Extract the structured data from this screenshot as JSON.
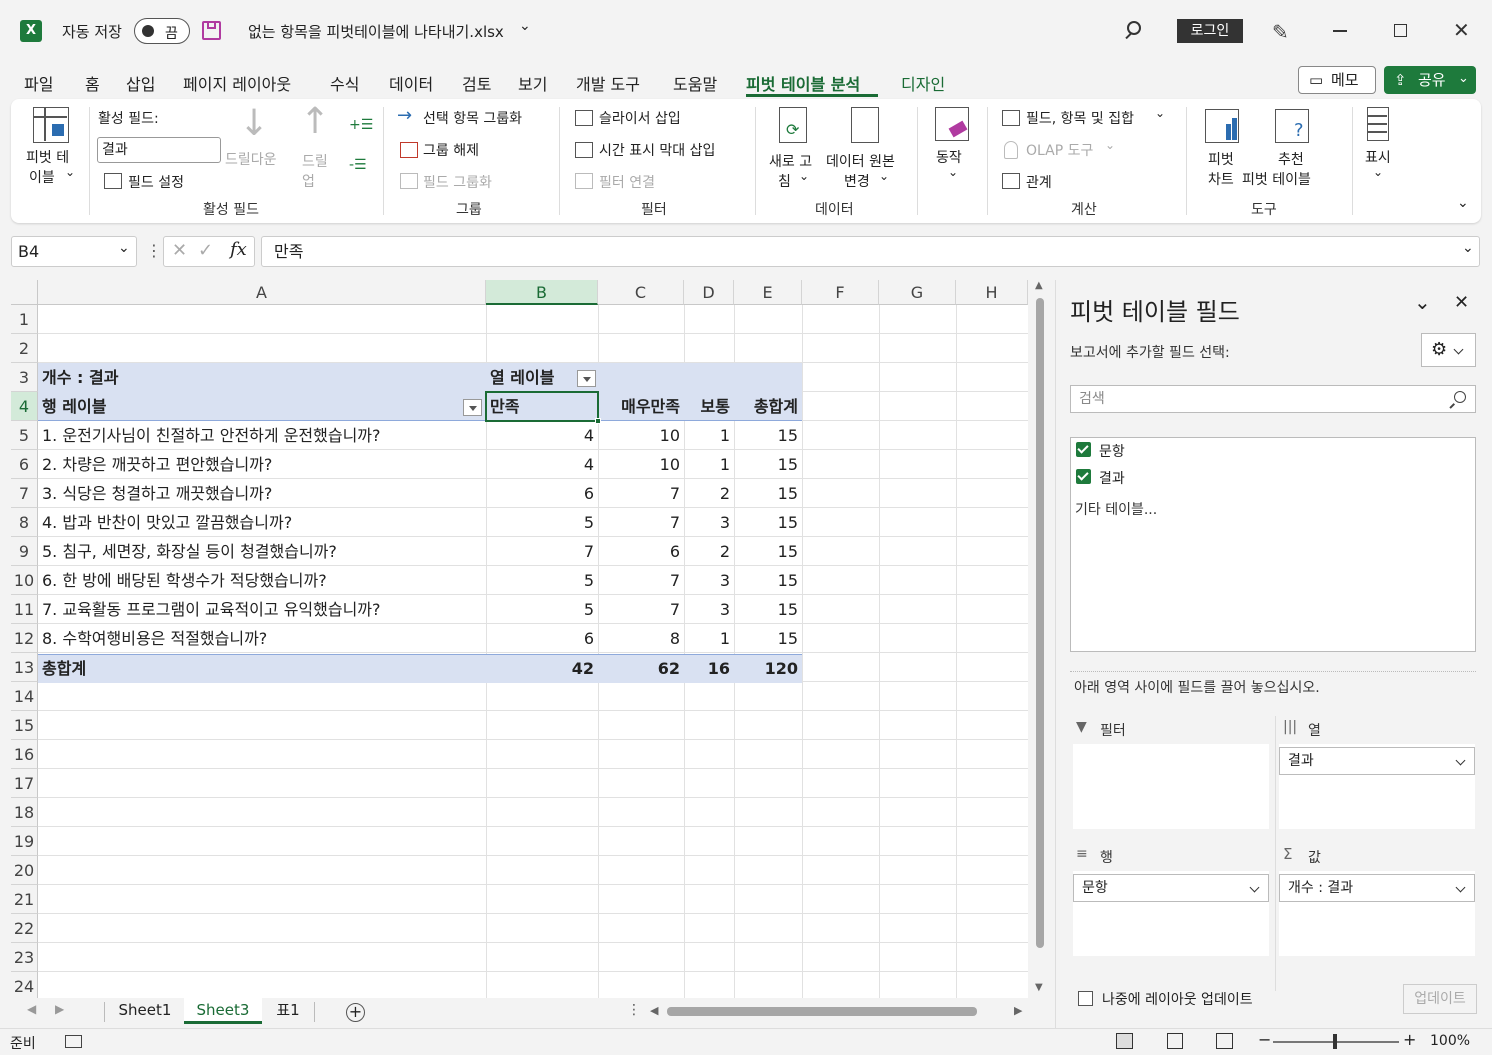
{
  "titlebar": {
    "autosave_label": "자동 저장",
    "autosave_state": "끔",
    "filename": "없는 항목을 피벗테이블에 나타내기.xlsx",
    "login": "로그인"
  },
  "menu": [
    "파일",
    "홈",
    "삽입",
    "페이지 레이아웃",
    "수식",
    "데이터",
    "검토",
    "보기",
    "개발 도구",
    "도움말",
    "피벗 테이블 분석",
    "디자인"
  ],
  "menu_active": "피벗 테이블 분석",
  "menu_right": {
    "memo": "메모",
    "share": "공유"
  },
  "ribbon": {
    "pivot_label_1": "피벗 테",
    "pivot_label_2": "이블",
    "active_field_label": "활성 필드:",
    "active_field_value": "결과",
    "field_settings": "필드 설정",
    "drilldown": "드릴다운",
    "drillup_1": "드릴",
    "drillup_2": "업",
    "group_active": "활성 필드",
    "group_selection": "선택 항목 그룹화",
    "ungroup": "그룹 해제",
    "group_field": "필드 그룹화",
    "group_group": "그룹",
    "insert_slicer": "슬라이서 삽입",
    "insert_timeline": "시간 표시 막대 삽입",
    "filter_connections": "필터 연결",
    "group_filter": "필터",
    "refresh_1": "새로 고",
    "refresh_2": "침",
    "change_source_1": "데이터 원본",
    "change_source_2": "변경",
    "group_data": "데이터",
    "actions": "동작",
    "fields_items_sets": "필드, 항목 및 집합",
    "olap_tools": "OLAP 도구",
    "relationships": "관계",
    "group_calc": "계산",
    "pivot_chart_1": "피벗",
    "pivot_chart_2": "차트",
    "recommended_1": "추천",
    "recommended_2": "피벗 테이블",
    "group_tools": "도구",
    "show": "표시"
  },
  "formula": {
    "namebox": "B4",
    "content": "만족"
  },
  "columns": [
    "A",
    "B",
    "C",
    "D",
    "E",
    "F",
    "G",
    "H"
  ],
  "rows": [
    "1",
    "2",
    "3",
    "4",
    "5",
    "6",
    "7",
    "8",
    "9",
    "10",
    "11",
    "12",
    "13",
    "14",
    "15",
    "16",
    "17",
    "18",
    "19",
    "20",
    "21",
    "22",
    "23",
    "24"
  ],
  "pivot": {
    "count_label": "개수 : 결과",
    "col_labels": "열 레이블",
    "row_labels": "행 레이블",
    "headers": [
      "만족",
      "매우만족",
      "보통",
      "총합계"
    ],
    "data": [
      {
        "q": "1. 운전기사님이 친절하고 안전하게 운전했습니까?",
        "v": [
          "4",
          "10",
          "1",
          "15"
        ]
      },
      {
        "q": "2. 차량은 깨끗하고 편안했습니까?",
        "v": [
          "4",
          "10",
          "1",
          "15"
        ]
      },
      {
        "q": "3. 식당은 청결하고 깨끗했습니까?",
        "v": [
          "6",
          "7",
          "2",
          "15"
        ]
      },
      {
        "q": "4. 밥과 반찬이 맛있고 깔끔했습니까?",
        "v": [
          "5",
          "7",
          "3",
          "15"
        ]
      },
      {
        "q": "5. 침구, 세면장, 화장실 등이 청결했습니까?",
        "v": [
          "7",
          "6",
          "2",
          "15"
        ]
      },
      {
        "q": "6. 한 방에 배당된 학생수가 적당했습니까?",
        "v": [
          "5",
          "7",
          "3",
          "15"
        ]
      },
      {
        "q": "7. 교육활동 프로그램이 교육적이고 유익했습니까?",
        "v": [
          "5",
          "7",
          "3",
          "15"
        ]
      },
      {
        "q": "8. 수학여행비용은 적절했습니까?",
        "v": [
          "6",
          "8",
          "1",
          "15"
        ]
      }
    ],
    "total_label": "총합계",
    "totals": [
      "42",
      "62",
      "16",
      "120"
    ]
  },
  "sheet_tabs": [
    "Sheet1",
    "Sheet3",
    "표1"
  ],
  "active_sheet": "Sheet3",
  "status": {
    "ready": "준비",
    "zoom": "100%"
  },
  "pane": {
    "title": "피벗 테이블 필드",
    "choose_fields": "보고서에 추가할 필드 선택:",
    "search_placeholder": "검색",
    "fields": [
      "문항",
      "결과"
    ],
    "more_tables": "기타 테이블...",
    "drag_hint": "아래 영역 사이에 필드를 끌어 놓으십시오.",
    "area_filter": "필터",
    "area_columns": "열",
    "area_rows": "행",
    "area_values": "값",
    "columns_field": "결과",
    "rows_field": "문항",
    "values_field": "개수 : 결과",
    "defer_update": "나중에 레이아웃 업데이트",
    "update": "업데이트"
  },
  "colors": {
    "accent": "#1e7a3c",
    "pivot_header": "#d9e1f2"
  }
}
